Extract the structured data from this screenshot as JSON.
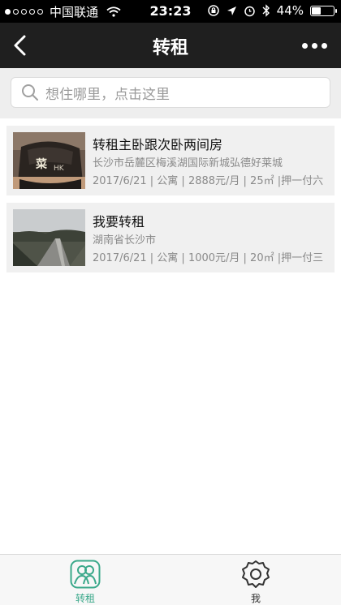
{
  "status_bar": {
    "carrier": "中国联通",
    "time": "23:23",
    "battery": "44%",
    "battery_level": 0.44
  },
  "nav": {
    "title": "转租"
  },
  "search": {
    "placeholder": "想住哪里，点击这里"
  },
  "listings": [
    {
      "title": "转租主卧跟次卧两间房",
      "address": "长沙市岳麓区梅溪湖国际新城弘德好莱城",
      "meta": "2017/6/21 | 公寓 | 2888元/月 | 25㎡ |押一付六"
    },
    {
      "title": "我要转租",
      "address": "湖南省长沙市",
      "meta": "2017/6/21 | 公寓 | 1000元/月 | 20㎡ |押一付三"
    }
  ],
  "tabs": [
    {
      "label": "转租",
      "icon": "people-icon",
      "active": true
    },
    {
      "label": "我",
      "icon": "gear-icon",
      "active": false
    }
  ],
  "colors": {
    "nav_bg": "#1f1f1f",
    "accent": "#3aa88a",
    "list_bg": "#f0f0f0"
  }
}
